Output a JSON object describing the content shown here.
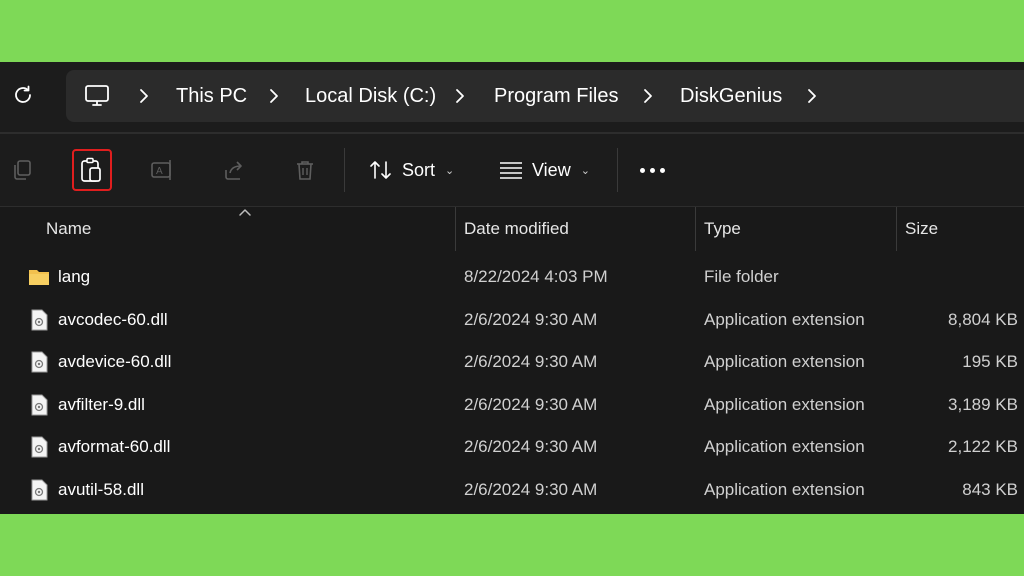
{
  "breadcrumb": [
    "This PC",
    "Local Disk (C:)",
    "Program Files",
    "DiskGenius"
  ],
  "toolbar": {
    "sort_label": "Sort",
    "view_label": "View"
  },
  "columns": {
    "name": "Name",
    "date": "Date modified",
    "type": "Type",
    "size": "Size"
  },
  "files": [
    {
      "name": "lang",
      "date": "8/22/2024 4:03 PM",
      "type": "File folder",
      "size": "",
      "icon": "folder-icon"
    },
    {
      "name": "avcodec-60.dll",
      "date": "2/6/2024 9:30 AM",
      "type": "Application extension",
      "size": "8,804 KB",
      "icon": "dll-file-icon"
    },
    {
      "name": "avdevice-60.dll",
      "date": "2/6/2024 9:30 AM",
      "type": "Application extension",
      "size": "195 KB",
      "icon": "dll-file-icon"
    },
    {
      "name": "avfilter-9.dll",
      "date": "2/6/2024 9:30 AM",
      "type": "Application extension",
      "size": "3,189 KB",
      "icon": "dll-file-icon"
    },
    {
      "name": "avformat-60.dll",
      "date": "2/6/2024 9:30 AM",
      "type": "Application extension",
      "size": "2,122 KB",
      "icon": "dll-file-icon"
    },
    {
      "name": "avutil-58.dll",
      "date": "2/6/2024 9:30 AM",
      "type": "Application extension",
      "size": "843 KB",
      "icon": "dll-file-icon"
    }
  ],
  "colors": {
    "background": "#7ed957",
    "window": "#191919",
    "address_bar": "#2b2b2b",
    "highlight_box": "#e01e1e",
    "folder": "#f2c14e"
  }
}
